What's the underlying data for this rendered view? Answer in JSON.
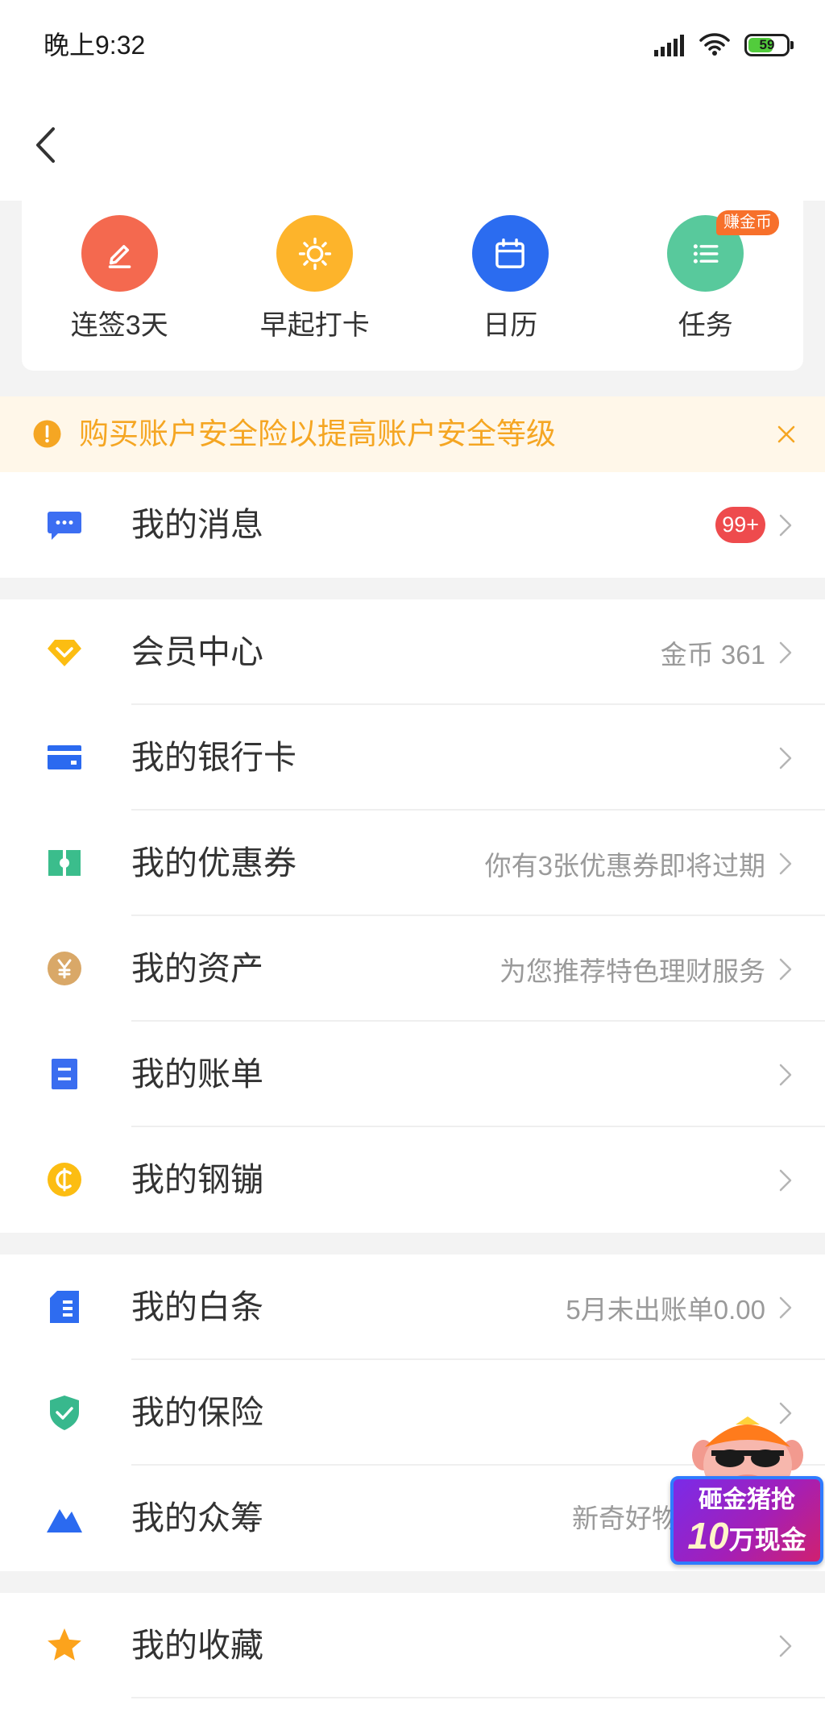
{
  "status_bar": {
    "time": "晚上9:32",
    "battery_level": "59",
    "icons": [
      "signal-icon",
      "wifi-icon",
      "battery-icon"
    ]
  },
  "header": {
    "back_icon": "chevron-left-icon"
  },
  "quick_actions": [
    {
      "label": "连签3天",
      "icon": "pencil-icon",
      "color": "#f4694f"
    },
    {
      "label": "早起打卡",
      "icon": "sun-icon",
      "color": "#fdb42b"
    },
    {
      "label": "日历",
      "icon": "calendar-icon",
      "color": "#2b6cf0"
    },
    {
      "label": "任务",
      "icon": "list-icon",
      "color": "#58c99c",
      "badge": "赚金币"
    }
  ],
  "notice": {
    "text": "购买账户安全险以提高账户安全等级",
    "icon": "exclamation-icon",
    "close_icon": "close-icon",
    "color": "#f5a623"
  },
  "sections": [
    {
      "items": [
        {
          "label": "我的消息",
          "icon": "chat-icon",
          "color": "#3c6ef2",
          "badge": "99+"
        }
      ]
    },
    {
      "items": [
        {
          "label": "会员中心",
          "icon": "diamond-icon",
          "color": "#fcbd12",
          "detail": "金币 361"
        },
        {
          "label": "我的银行卡",
          "icon": "bank-card-icon",
          "color": "#2b6af0"
        },
        {
          "label": "我的优惠券",
          "icon": "coupon-icon",
          "color": "#3bbd8c",
          "detail": "你有3张优惠券即将过期"
        },
        {
          "label": "我的资产",
          "icon": "yuan-coin-icon",
          "color": "#d9a868",
          "detail": "为您推荐特色理财服务"
        },
        {
          "label": "我的账单",
          "icon": "bill-icon",
          "color": "#3a6df0"
        },
        {
          "label": "我的钢镚",
          "icon": "coin-icon",
          "color": "#fcbd12"
        }
      ]
    },
    {
      "items": [
        {
          "label": "我的白条",
          "icon": "iou-document-icon",
          "color": "#2e6cf0",
          "detail": "5月未出账单0.00"
        },
        {
          "label": "我的保险",
          "icon": "shield-check-icon",
          "color": "#38b88d"
        },
        {
          "label": "我的众筹",
          "icon": "mountain-icon",
          "color": "#2b6af0",
          "detail": "新奇好物"
        }
      ]
    },
    {
      "items": [
        {
          "label": "我的收藏",
          "icon": "star-icon",
          "color": "#fca31c"
        }
      ]
    }
  ],
  "promo": {
    "icon": "pig-icon",
    "line1": "砸金猪抢",
    "amount": "10",
    "line2": "万现金"
  }
}
